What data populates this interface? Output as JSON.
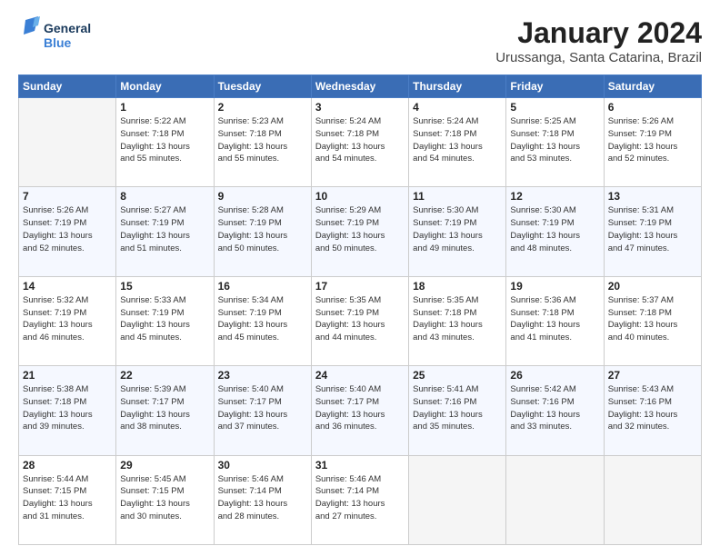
{
  "header": {
    "logo_line1": "General",
    "logo_line2": "Blue",
    "main_title": "January 2024",
    "subtitle": "Urussanga, Santa Catarina, Brazil"
  },
  "days_of_week": [
    "Sunday",
    "Monday",
    "Tuesday",
    "Wednesday",
    "Thursday",
    "Friday",
    "Saturday"
  ],
  "weeks": [
    [
      {
        "day": "",
        "info": ""
      },
      {
        "day": "1",
        "info": "Sunrise: 5:22 AM\nSunset: 7:18 PM\nDaylight: 13 hours\nand 55 minutes."
      },
      {
        "day": "2",
        "info": "Sunrise: 5:23 AM\nSunset: 7:18 PM\nDaylight: 13 hours\nand 55 minutes."
      },
      {
        "day": "3",
        "info": "Sunrise: 5:24 AM\nSunset: 7:18 PM\nDaylight: 13 hours\nand 54 minutes."
      },
      {
        "day": "4",
        "info": "Sunrise: 5:24 AM\nSunset: 7:18 PM\nDaylight: 13 hours\nand 54 minutes."
      },
      {
        "day": "5",
        "info": "Sunrise: 5:25 AM\nSunset: 7:18 PM\nDaylight: 13 hours\nand 53 minutes."
      },
      {
        "day": "6",
        "info": "Sunrise: 5:26 AM\nSunset: 7:19 PM\nDaylight: 13 hours\nand 52 minutes."
      }
    ],
    [
      {
        "day": "7",
        "info": "Sunrise: 5:26 AM\nSunset: 7:19 PM\nDaylight: 13 hours\nand 52 minutes."
      },
      {
        "day": "8",
        "info": "Sunrise: 5:27 AM\nSunset: 7:19 PM\nDaylight: 13 hours\nand 51 minutes."
      },
      {
        "day": "9",
        "info": "Sunrise: 5:28 AM\nSunset: 7:19 PM\nDaylight: 13 hours\nand 50 minutes."
      },
      {
        "day": "10",
        "info": "Sunrise: 5:29 AM\nSunset: 7:19 PM\nDaylight: 13 hours\nand 50 minutes."
      },
      {
        "day": "11",
        "info": "Sunrise: 5:30 AM\nSunset: 7:19 PM\nDaylight: 13 hours\nand 49 minutes."
      },
      {
        "day": "12",
        "info": "Sunrise: 5:30 AM\nSunset: 7:19 PM\nDaylight: 13 hours\nand 48 minutes."
      },
      {
        "day": "13",
        "info": "Sunrise: 5:31 AM\nSunset: 7:19 PM\nDaylight: 13 hours\nand 47 minutes."
      }
    ],
    [
      {
        "day": "14",
        "info": "Sunrise: 5:32 AM\nSunset: 7:19 PM\nDaylight: 13 hours\nand 46 minutes."
      },
      {
        "day": "15",
        "info": "Sunrise: 5:33 AM\nSunset: 7:19 PM\nDaylight: 13 hours\nand 45 minutes."
      },
      {
        "day": "16",
        "info": "Sunrise: 5:34 AM\nSunset: 7:19 PM\nDaylight: 13 hours\nand 45 minutes."
      },
      {
        "day": "17",
        "info": "Sunrise: 5:35 AM\nSunset: 7:19 PM\nDaylight: 13 hours\nand 44 minutes."
      },
      {
        "day": "18",
        "info": "Sunrise: 5:35 AM\nSunset: 7:18 PM\nDaylight: 13 hours\nand 43 minutes."
      },
      {
        "day": "19",
        "info": "Sunrise: 5:36 AM\nSunset: 7:18 PM\nDaylight: 13 hours\nand 41 minutes."
      },
      {
        "day": "20",
        "info": "Sunrise: 5:37 AM\nSunset: 7:18 PM\nDaylight: 13 hours\nand 40 minutes."
      }
    ],
    [
      {
        "day": "21",
        "info": "Sunrise: 5:38 AM\nSunset: 7:18 PM\nDaylight: 13 hours\nand 39 minutes."
      },
      {
        "day": "22",
        "info": "Sunrise: 5:39 AM\nSunset: 7:17 PM\nDaylight: 13 hours\nand 38 minutes."
      },
      {
        "day": "23",
        "info": "Sunrise: 5:40 AM\nSunset: 7:17 PM\nDaylight: 13 hours\nand 37 minutes."
      },
      {
        "day": "24",
        "info": "Sunrise: 5:40 AM\nSunset: 7:17 PM\nDaylight: 13 hours\nand 36 minutes."
      },
      {
        "day": "25",
        "info": "Sunrise: 5:41 AM\nSunset: 7:16 PM\nDaylight: 13 hours\nand 35 minutes."
      },
      {
        "day": "26",
        "info": "Sunrise: 5:42 AM\nSunset: 7:16 PM\nDaylight: 13 hours\nand 33 minutes."
      },
      {
        "day": "27",
        "info": "Sunrise: 5:43 AM\nSunset: 7:16 PM\nDaylight: 13 hours\nand 32 minutes."
      }
    ],
    [
      {
        "day": "28",
        "info": "Sunrise: 5:44 AM\nSunset: 7:15 PM\nDaylight: 13 hours\nand 31 minutes."
      },
      {
        "day": "29",
        "info": "Sunrise: 5:45 AM\nSunset: 7:15 PM\nDaylight: 13 hours\nand 30 minutes."
      },
      {
        "day": "30",
        "info": "Sunrise: 5:46 AM\nSunset: 7:14 PM\nDaylight: 13 hours\nand 28 minutes."
      },
      {
        "day": "31",
        "info": "Sunrise: 5:46 AM\nSunset: 7:14 PM\nDaylight: 13 hours\nand 27 minutes."
      },
      {
        "day": "",
        "info": ""
      },
      {
        "day": "",
        "info": ""
      },
      {
        "day": "",
        "info": ""
      }
    ]
  ]
}
